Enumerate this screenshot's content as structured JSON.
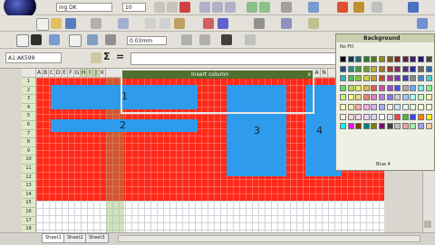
{
  "toolbar": {
    "font_name": "ing DK",
    "font_size": "10",
    "zoom_value": "0.03mm"
  },
  "formula_bar": {
    "name_box": "A1:AK599",
    "sum_symbol": "Σ",
    "equals_symbol": "="
  },
  "dialog": {
    "title": "Insert column",
    "close": "x"
  },
  "columns": [
    "A",
    "B",
    "C",
    "D",
    "E",
    "F",
    "G",
    "H",
    "I",
    "J",
    "K"
  ],
  "columns_right": [
    "M",
    "A",
    "N"
  ],
  "rows": [
    "1",
    "2",
    "3",
    "4",
    "5",
    "6",
    "7",
    "8",
    "9",
    "10",
    "11",
    "12",
    "13",
    "14",
    "15",
    "16",
    "17",
    "18"
  ],
  "blocks": {
    "b1": "1",
    "b2": "2",
    "b3": "3",
    "b4": "4"
  },
  "palette": {
    "title": "Background",
    "no_fill": "No Fill",
    "bottom_label": "Blue 4",
    "colors": [
      "#000000",
      "#0b3b5c",
      "#1d6a6a",
      "#2b7a2b",
      "#4d7a1a",
      "#8a8a1a",
      "#7a5a1a",
      "#7a2b1a",
      "#6a1a4a",
      "#3a1a6a",
      "#1a1a7a",
      "#444444",
      "#1a4a8a",
      "#2a8a8a",
      "#3aa03a",
      "#6aa02a",
      "#b0b02a",
      "#a07a2a",
      "#a03a2a",
      "#8a2a6a",
      "#5a2a8a",
      "#2a2aa0",
      "#666666",
      "#2a6ab0",
      "#3ab0b0",
      "#4ac04a",
      "#8ac03a",
      "#d0d03a",
      "#c09a3a",
      "#c04a3a",
      "#b03a8a",
      "#7a3ab0",
      "#3a3ac0",
      "#888888",
      "#3a8ad0",
      "#4ad0d0",
      "#5ae05a",
      "#aae04a",
      "#f0f04a",
      "#e0ba4a",
      "#e05a4a",
      "#d04aaa",
      "#9a4ad0",
      "#4a4ae0",
      "#aaaaaa",
      "#6aaaf0",
      "#7af0f0",
      "#8af08a",
      "#caf07a",
      "#ffff7a",
      "#f0da7a",
      "#f07a7a",
      "#f07aca",
      "#ba7af0",
      "#7a7af0",
      "#cccccc",
      "#9acaff",
      "#aaffff",
      "#baffba",
      "#eaffaa",
      "#ffffaa",
      "#ffeaaa",
      "#ffaaaa",
      "#ffaaea",
      "#daaaff",
      "#aaaaff",
      "#eeeeee",
      "#cce4ff",
      "#dcffff",
      "#e4ffe4",
      "#f4ffd4",
      "#ffffd4",
      "#fff4d4",
      "#ffd4d4",
      "#ffd4f4",
      "#eed4ff",
      "#d4d4ff",
      "#ffffff",
      "#e0e0e0",
      "#ff4040",
      "#40c040",
      "#4040ff",
      "#ff8000",
      "#ffff00",
      "#00ffff",
      "#ff00ff",
      "#804000",
      "#008080",
      "#808000",
      "#800080",
      "#404040",
      "#c0c0c0",
      "#f0a0a0",
      "#a0f0a0",
      "#a0a0f0",
      "#f0d0a0"
    ]
  },
  "sheet_tabs": [
    "Sheet1",
    "Sheet2",
    "Sheet3"
  ]
}
